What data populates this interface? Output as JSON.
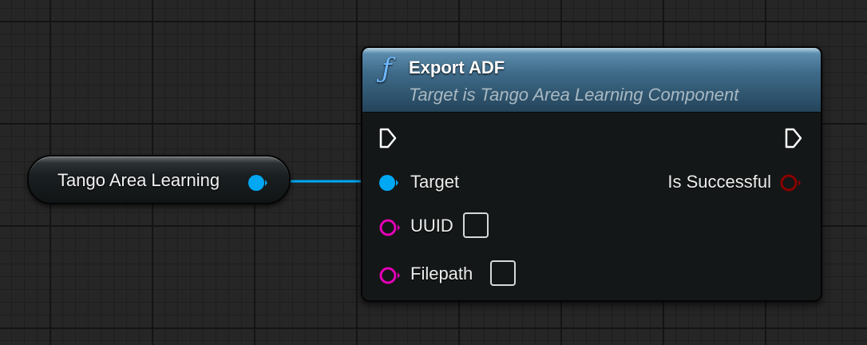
{
  "variable_node": {
    "label": "Tango Area Learning"
  },
  "function_node": {
    "title": "Export ADF",
    "subtitle": "Target is Tango Area Learning Component",
    "icon": "function-icon",
    "inputs": [
      {
        "label": "Target"
      },
      {
        "label": "UUID",
        "value": ""
      },
      {
        "label": "Filepath",
        "value": ""
      }
    ],
    "outputs": [
      {
        "label": "Is Successful"
      }
    ]
  },
  "colors": {
    "object_pin": "#00a8f3",
    "string_pin": "#e500b8",
    "bool_pin": "#8b0000",
    "exec_pin": "#ffffff",
    "header": "#3e6a88"
  }
}
